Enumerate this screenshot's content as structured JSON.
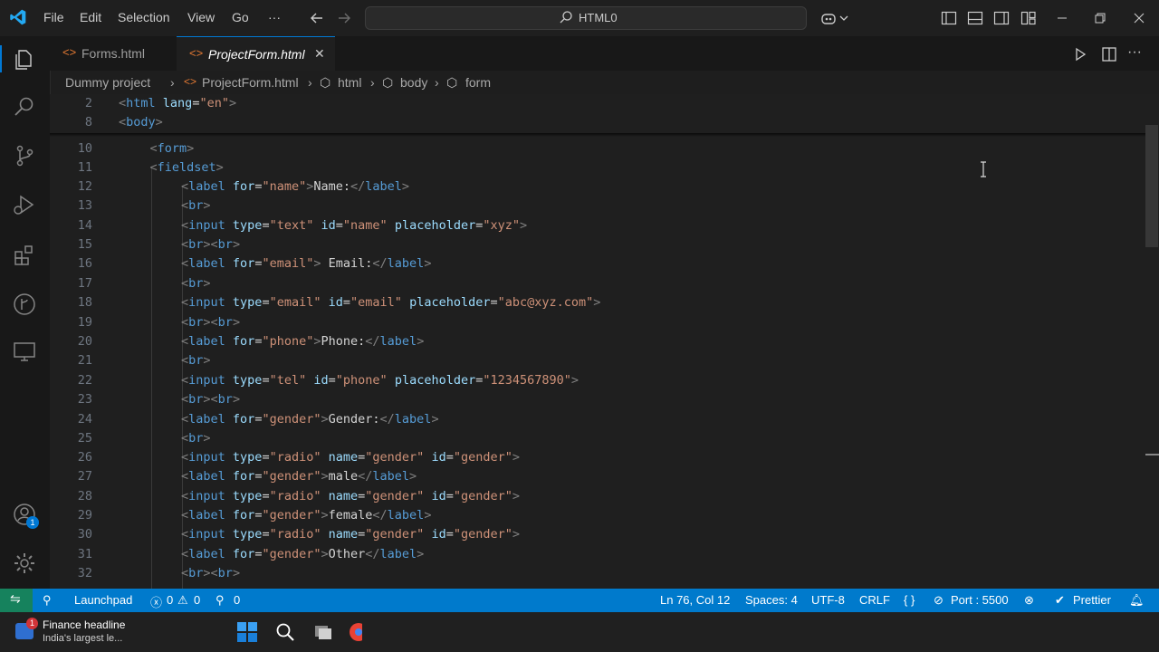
{
  "window": {
    "search_text": "HTML0"
  },
  "menu": {
    "file": "File",
    "edit": "Edit",
    "selection": "Selection",
    "view": "View",
    "go": "Go",
    "more": "···"
  },
  "tabs": [
    {
      "label": "Forms.html",
      "active": false
    },
    {
      "label": "ProjectForm.html",
      "active": true,
      "close": "✕"
    }
  ],
  "breadcrumb": {
    "folder": "Dummy project",
    "file": "ProjectForm.html",
    "html": "html",
    "body": "body",
    "form": "form"
  },
  "editor_lines": [
    {
      "n": "2",
      "indent": 0,
      "tokens": [
        [
          "tg",
          "<"
        ],
        [
          "tn",
          "html"
        ],
        [
          "tx",
          " "
        ],
        [
          "at",
          "lang"
        ],
        [
          "tx",
          "="
        ],
        [
          "sv",
          "\"en\""
        ],
        [
          "tg",
          ">"
        ]
      ]
    },
    {
      "n": "8",
      "indent": 0,
      "tokens": [
        [
          "tg",
          "<"
        ],
        [
          "tn",
          "body"
        ],
        [
          "tg",
          ">"
        ]
      ]
    },
    {
      "n": "10",
      "indent": 1,
      "tokens": [
        [
          "tg",
          "<"
        ],
        [
          "tn",
          "form"
        ],
        [
          "tg",
          ">"
        ]
      ]
    },
    {
      "n": "11",
      "indent": 1,
      "tokens": [
        [
          "tg",
          "<"
        ],
        [
          "tn",
          "fieldset"
        ],
        [
          "tg",
          ">"
        ]
      ]
    },
    {
      "n": "12",
      "indent": 2,
      "tokens": [
        [
          "tg",
          "<"
        ],
        [
          "tn",
          "label"
        ],
        [
          "tx",
          " "
        ],
        [
          "at",
          "for"
        ],
        [
          "tx",
          "="
        ],
        [
          "sv",
          "\"name\""
        ],
        [
          "tg",
          ">"
        ],
        [
          "tx",
          "Name:"
        ],
        [
          "tg",
          "</"
        ],
        [
          "tn",
          "label"
        ],
        [
          "tg",
          ">"
        ]
      ]
    },
    {
      "n": "13",
      "indent": 2,
      "tokens": [
        [
          "tg",
          "<"
        ],
        [
          "tn",
          "br"
        ],
        [
          "tg",
          ">"
        ]
      ]
    },
    {
      "n": "14",
      "indent": 2,
      "tokens": [
        [
          "tg",
          "<"
        ],
        [
          "tn",
          "input"
        ],
        [
          "tx",
          " "
        ],
        [
          "at",
          "type"
        ],
        [
          "tx",
          "="
        ],
        [
          "sv",
          "\"text\""
        ],
        [
          "tx",
          " "
        ],
        [
          "at",
          "id"
        ],
        [
          "tx",
          "="
        ],
        [
          "sv",
          "\"name\""
        ],
        [
          "tx",
          " "
        ],
        [
          "at",
          "placeholder"
        ],
        [
          "tx",
          "="
        ],
        [
          "sv",
          "\"xyz\""
        ],
        [
          "tg",
          ">"
        ]
      ]
    },
    {
      "n": "15",
      "indent": 2,
      "tokens": [
        [
          "tg",
          "<"
        ],
        [
          "tn",
          "br"
        ],
        [
          "tg",
          "><"
        ],
        [
          "tn",
          "br"
        ],
        [
          "tg",
          ">"
        ]
      ]
    },
    {
      "n": "16",
      "indent": 2,
      "tokens": [
        [
          "tg",
          "<"
        ],
        [
          "tn",
          "label"
        ],
        [
          "tx",
          " "
        ],
        [
          "at",
          "for"
        ],
        [
          "tx",
          "="
        ],
        [
          "sv",
          "\"email\""
        ],
        [
          "tg",
          ">"
        ],
        [
          "tx",
          " Email:"
        ],
        [
          "tg",
          "</"
        ],
        [
          "tn",
          "label"
        ],
        [
          "tg",
          ">"
        ]
      ]
    },
    {
      "n": "17",
      "indent": 2,
      "tokens": [
        [
          "tg",
          "<"
        ],
        [
          "tn",
          "br"
        ],
        [
          "tg",
          ">"
        ]
      ]
    },
    {
      "n": "18",
      "indent": 2,
      "tokens": [
        [
          "tg",
          "<"
        ],
        [
          "tn",
          "input"
        ],
        [
          "tx",
          " "
        ],
        [
          "at",
          "type"
        ],
        [
          "tx",
          "="
        ],
        [
          "sv",
          "\"email\""
        ],
        [
          "tx",
          " "
        ],
        [
          "at",
          "id"
        ],
        [
          "tx",
          "="
        ],
        [
          "sv",
          "\"email\""
        ],
        [
          "tx",
          " "
        ],
        [
          "at",
          "placeholder"
        ],
        [
          "tx",
          "="
        ],
        [
          "sv",
          "\"abc@xyz.com\""
        ],
        [
          "tg",
          ">"
        ]
      ]
    },
    {
      "n": "19",
      "indent": 2,
      "tokens": [
        [
          "tg",
          "<"
        ],
        [
          "tn",
          "br"
        ],
        [
          "tg",
          "><"
        ],
        [
          "tn",
          "br"
        ],
        [
          "tg",
          ">"
        ]
      ]
    },
    {
      "n": "20",
      "indent": 2,
      "tokens": [
        [
          "tg",
          "<"
        ],
        [
          "tn",
          "label"
        ],
        [
          "tx",
          " "
        ],
        [
          "at",
          "for"
        ],
        [
          "tx",
          "="
        ],
        [
          "sv",
          "\"phone\""
        ],
        [
          "tg",
          ">"
        ],
        [
          "tx",
          "Phone:"
        ],
        [
          "tg",
          "</"
        ],
        [
          "tn",
          "label"
        ],
        [
          "tg",
          ">"
        ]
      ]
    },
    {
      "n": "21",
      "indent": 2,
      "tokens": [
        [
          "tg",
          "<"
        ],
        [
          "tn",
          "br"
        ],
        [
          "tg",
          ">"
        ]
      ]
    },
    {
      "n": "22",
      "indent": 2,
      "tokens": [
        [
          "tg",
          "<"
        ],
        [
          "tn",
          "input"
        ],
        [
          "tx",
          " "
        ],
        [
          "at",
          "type"
        ],
        [
          "tx",
          "="
        ],
        [
          "sv",
          "\"tel\""
        ],
        [
          "tx",
          " "
        ],
        [
          "at",
          "id"
        ],
        [
          "tx",
          "="
        ],
        [
          "sv",
          "\"phone\""
        ],
        [
          "tx",
          " "
        ],
        [
          "at",
          "placeholder"
        ],
        [
          "tx",
          "="
        ],
        [
          "sv",
          "\"1234567890\""
        ],
        [
          "tg",
          ">"
        ]
      ]
    },
    {
      "n": "23",
      "indent": 2,
      "tokens": [
        [
          "tg",
          "<"
        ],
        [
          "tn",
          "br"
        ],
        [
          "tg",
          "><"
        ],
        [
          "tn",
          "br"
        ],
        [
          "tg",
          ">"
        ]
      ]
    },
    {
      "n": "24",
      "indent": 2,
      "tokens": [
        [
          "tg",
          "<"
        ],
        [
          "tn",
          "label"
        ],
        [
          "tx",
          " "
        ],
        [
          "at",
          "for"
        ],
        [
          "tx",
          "="
        ],
        [
          "sv",
          "\"gender\""
        ],
        [
          "tg",
          ">"
        ],
        [
          "tx",
          "Gender:"
        ],
        [
          "tg",
          "</"
        ],
        [
          "tn",
          "label"
        ],
        [
          "tg",
          ">"
        ]
      ]
    },
    {
      "n": "25",
      "indent": 2,
      "tokens": [
        [
          "tg",
          "<"
        ],
        [
          "tn",
          "br"
        ],
        [
          "tg",
          ">"
        ]
      ]
    },
    {
      "n": "26",
      "indent": 2,
      "tokens": [
        [
          "tg",
          "<"
        ],
        [
          "tn",
          "input"
        ],
        [
          "tx",
          " "
        ],
        [
          "at",
          "type"
        ],
        [
          "tx",
          "="
        ],
        [
          "sv",
          "\"radio\""
        ],
        [
          "tx",
          " "
        ],
        [
          "at",
          "name"
        ],
        [
          "tx",
          "="
        ],
        [
          "sv",
          "\"gender\""
        ],
        [
          "tx",
          " "
        ],
        [
          "at",
          "id"
        ],
        [
          "tx",
          "="
        ],
        [
          "sv",
          "\"gender\""
        ],
        [
          "tg",
          ">"
        ]
      ]
    },
    {
      "n": "27",
      "indent": 2,
      "tokens": [
        [
          "tg",
          "<"
        ],
        [
          "tn",
          "label"
        ],
        [
          "tx",
          " "
        ],
        [
          "at",
          "for"
        ],
        [
          "tx",
          "="
        ],
        [
          "sv",
          "\"gender\""
        ],
        [
          "tg",
          ">"
        ],
        [
          "tx",
          "male"
        ],
        [
          "tg",
          "</"
        ],
        [
          "tn",
          "label"
        ],
        [
          "tg",
          ">"
        ]
      ]
    },
    {
      "n": "28",
      "indent": 2,
      "tokens": [
        [
          "tg",
          "<"
        ],
        [
          "tn",
          "input"
        ],
        [
          "tx",
          " "
        ],
        [
          "at",
          "type"
        ],
        [
          "tx",
          "="
        ],
        [
          "sv",
          "\"radio\""
        ],
        [
          "tx",
          " "
        ],
        [
          "at",
          "name"
        ],
        [
          "tx",
          "="
        ],
        [
          "sv",
          "\"gender\""
        ],
        [
          "tx",
          " "
        ],
        [
          "at",
          "id"
        ],
        [
          "tx",
          "="
        ],
        [
          "sv",
          "\"gender\""
        ],
        [
          "tg",
          ">"
        ]
      ]
    },
    {
      "n": "29",
      "indent": 2,
      "tokens": [
        [
          "tg",
          "<"
        ],
        [
          "tn",
          "label"
        ],
        [
          "tx",
          " "
        ],
        [
          "at",
          "for"
        ],
        [
          "tx",
          "="
        ],
        [
          "sv",
          "\"gender\""
        ],
        [
          "tg",
          ">"
        ],
        [
          "tx",
          "female"
        ],
        [
          "tg",
          "</"
        ],
        [
          "tn",
          "label"
        ],
        [
          "tg",
          ">"
        ]
      ]
    },
    {
      "n": "30",
      "indent": 2,
      "tokens": [
        [
          "tg",
          "<"
        ],
        [
          "tn",
          "input"
        ],
        [
          "tx",
          " "
        ],
        [
          "at",
          "type"
        ],
        [
          "tx",
          "="
        ],
        [
          "sv",
          "\"radio\""
        ],
        [
          "tx",
          " "
        ],
        [
          "at",
          "name"
        ],
        [
          "tx",
          "="
        ],
        [
          "sv",
          "\"gender\""
        ],
        [
          "tx",
          " "
        ],
        [
          "at",
          "id"
        ],
        [
          "tx",
          "="
        ],
        [
          "sv",
          "\"gender\""
        ],
        [
          "tg",
          ">"
        ]
      ]
    },
    {
      "n": "31",
      "indent": 2,
      "tokens": [
        [
          "tg",
          "<"
        ],
        [
          "tn",
          "label"
        ],
        [
          "tx",
          " "
        ],
        [
          "at",
          "for"
        ],
        [
          "tx",
          "="
        ],
        [
          "sv",
          "\"gender\""
        ],
        [
          "tg",
          ">"
        ],
        [
          "tx",
          "Other"
        ],
        [
          "tg",
          "</"
        ],
        [
          "tn",
          "label"
        ],
        [
          "tg",
          ">"
        ]
      ]
    },
    {
      "n": "32",
      "indent": 2,
      "tokens": [
        [
          "tg",
          "<"
        ],
        [
          "tn",
          "br"
        ],
        [
          "tg",
          "><"
        ],
        [
          "tn",
          "br"
        ],
        [
          "tg",
          ">"
        ]
      ]
    }
  ],
  "status": {
    "launchpad": "Launchpad",
    "errors": "0",
    "warnings": "0",
    "ports": "0",
    "position": "Ln 76, Col 12",
    "spaces": "Spaces: 4",
    "encoding": "UTF-8",
    "eol": "CRLF",
    "language": "{ }",
    "port": "Port : 5500",
    "prettier": "Prettier"
  },
  "activity_badge": "1",
  "taskbar": {
    "news_title": "Finance headline",
    "news_sub": "India's largest le...",
    "news_badge": "1"
  },
  "colors": {
    "accent": "#007acc",
    "tag": "#569cd6",
    "attr": "#9cdcfe",
    "string": "#ce9178"
  }
}
